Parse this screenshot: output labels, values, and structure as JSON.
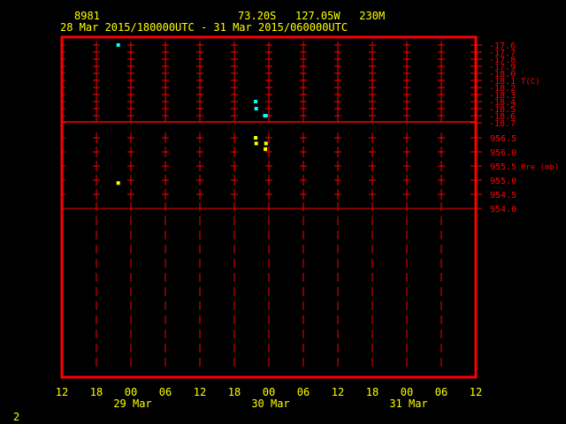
{
  "header": {
    "station_id": "8981",
    "location": "73.20S   127.05W   230M",
    "time_range": "28 Mar 2015/180000UTC - 31 Mar 2015/060000UTC"
  },
  "page_number": "2",
  "colors": {
    "frame": "#ff0000",
    "text": "#ffff00",
    "temperature": "#00ffff",
    "pressure": "#ffff00"
  },
  "chart_data": {
    "type": "scatter",
    "x_unit": "hours since 28 Mar 2015 12 UTC",
    "xlim": [
      0,
      72
    ],
    "x_ticks": [
      "12",
      "18",
      "00",
      "06",
      "12",
      "18",
      "00",
      "06",
      "12",
      "18",
      "00",
      "06",
      "12"
    ],
    "date_labels": [
      {
        "label": "29 Mar",
        "hour": 12
      },
      {
        "label": "30 Mar",
        "hour": 36
      },
      {
        "label": "31 Mar",
        "hour": 60
      }
    ],
    "panels": [
      {
        "name": "temperature",
        "ylabel": "T(C)",
        "ylim": [
          -18.7,
          -17.6
        ],
        "y_ticks": [
          "-17.6",
          "-17.7",
          "-17.8",
          "-17.9",
          "-18.0",
          "-18.1",
          "-18.2",
          "-18.3",
          "-18.4",
          "-18.5",
          "-18.6",
          "-18.7"
        ],
        "points": [
          [
            9.8,
            -17.6
          ],
          [
            33.7,
            -18.4
          ],
          [
            33.8,
            -18.5
          ],
          [
            35.3,
            -18.6
          ],
          [
            35.5,
            -18.6
          ]
        ]
      },
      {
        "name": "pressure",
        "ylabel": "Pre (mb)",
        "ylim": [
          954.0,
          956.5
        ],
        "y_ticks": [
          "956.5",
          "956.0",
          "955.5",
          "955.0",
          "954.5",
          "954.0"
        ],
        "points": [
          [
            9.8,
            954.9
          ],
          [
            33.7,
            956.5
          ],
          [
            33.8,
            956.3
          ],
          [
            35.5,
            956.3
          ],
          [
            35.4,
            956.1
          ]
        ]
      }
    ]
  }
}
